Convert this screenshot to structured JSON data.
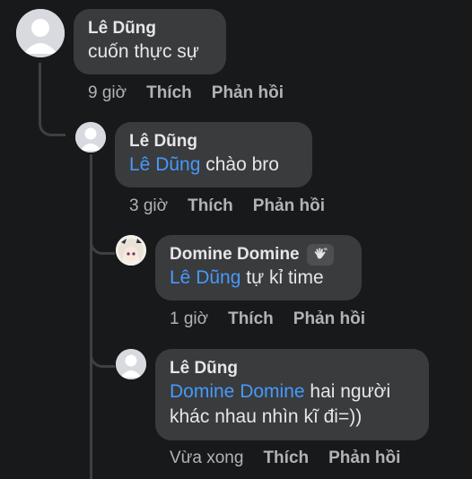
{
  "comments": [
    {
      "author": "Lê Dũng",
      "mention": "",
      "text": "cuốn thực sự",
      "time": "9 giờ",
      "like_label": "Thích",
      "reply_label": "Phản hồi"
    },
    {
      "author": "Lê Dũng",
      "mention": "Lê Dũng",
      "text": " chào bro",
      "time": "3 giờ",
      "like_label": "Thích",
      "reply_label": "Phản hồi"
    },
    {
      "author": "Domine Domine",
      "author_badge_icon": "waving-hand-icon",
      "mention": "Lê Dũng",
      "text": " tự kỉ time",
      "time": "1 giờ",
      "like_label": "Thích",
      "reply_label": "Phản hồi"
    },
    {
      "author": "Lê Dũng",
      "mention": "Domine Domine",
      "text_line1": " hai người",
      "text_line2": "khác nhau nhìn kĩ đi=))",
      "time": "Vừa xong",
      "like_label": "Thích",
      "reply_label": "Phản hồi"
    }
  ],
  "colors": {
    "background": "#18191a",
    "bubble": "#3a3b3c",
    "mention": "#4599ff",
    "secondary_text": "#b0b3b8",
    "primary_text": "#e4e6eb"
  }
}
